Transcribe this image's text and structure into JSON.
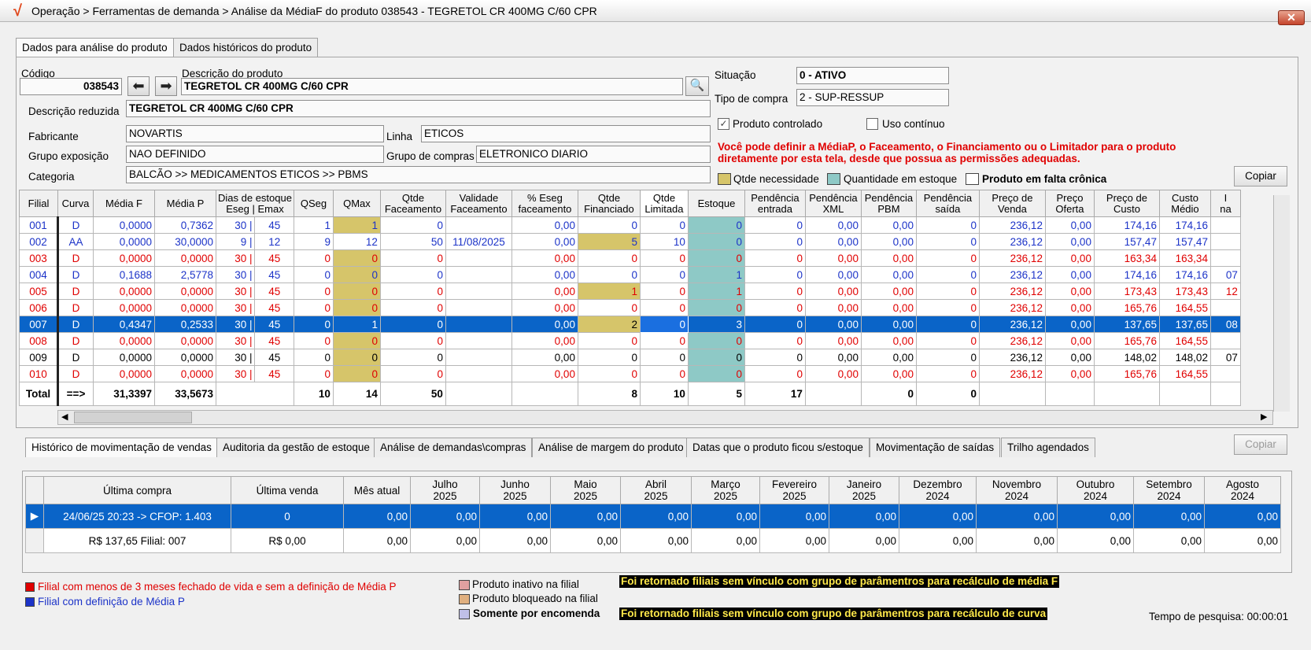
{
  "window": {
    "title": "Operação > Ferramentas de demanda > Análise da MédiaF do produto 038543 - TEGRETOL CR 400MG C/60 CPR",
    "close_label": "✕"
  },
  "tabs": [
    "Dados para análise do produto",
    "Dados históricos do produto"
  ],
  "form": {
    "codigo_label": "Código",
    "codigo": "038543",
    "descricao_label": "Descrição do produto",
    "descricao": "TEGRETOL CR 400MG C/60 CPR",
    "desc_reduzida_label": "Descrição reduzida",
    "desc_reduzida": "TEGRETOL CR 400MG C/60 CPR",
    "fabricante_label": "Fabricante",
    "fabricante": "NOVARTIS",
    "linha_label": "Linha",
    "linha": "ETICOS",
    "grupo_exposicao_label": "Grupo exposição",
    "grupo_exposicao": "NAO DEFINIDO",
    "grupo_compras_label": "Grupo de compras",
    "grupo_compras": "ELETRONICO DIARIO",
    "categoria_label": "Categoria",
    "categoria": "BALCÃO >> MEDICAMENTOS ETICOS >> PBMS",
    "situacao_label": "Situação",
    "situacao": "0 - ATIVO",
    "tipo_compra_label": "Tipo de compra",
    "tipo_compra": "2 - SUP-RESSUP",
    "produto_controlado_label": "Produto controlado",
    "produto_controlado": true,
    "uso_continuo_label": "Uso contínuo",
    "uso_continuo": false
  },
  "warning": "Você pode definir a MédiaP, o Faceamento, o Financiamento ou o Limitador para o produto diretamente por esta tela, desde que possua as permissões adequadas.",
  "legend_top": {
    "necessidade": "Qtde necessidade",
    "estoque": "Quantidade em estoque",
    "falta": "Produto em falta crônica"
  },
  "copy_label": "Copiar",
  "grid": {
    "headers": [
      [
        "Filial"
      ],
      [
        "Curva"
      ],
      [
        "Média F"
      ],
      [
        "Média P"
      ],
      [
        "Dias de estoque",
        "Eseg | Emax"
      ],
      [
        "QSeg"
      ],
      [
        "QMax"
      ],
      [
        "Qtde",
        "Faceamento"
      ],
      [
        "Validade",
        "Faceamento"
      ],
      [
        "% Eseg",
        "faceamento"
      ],
      [
        "Qtde",
        "Financiado"
      ],
      [
        "Qtde",
        "Limitada"
      ],
      [
        "Estoque"
      ],
      [
        "Pendência",
        "entrada"
      ],
      [
        "Pendência",
        "XML"
      ],
      [
        "Pendência",
        "PBM"
      ],
      [
        "Pendência",
        "saída"
      ],
      [
        "Preço de",
        "Venda"
      ],
      [
        "Preço",
        "Oferta"
      ],
      [
        "Preço de",
        "Custo"
      ],
      [
        "Custo",
        "Médio"
      ],
      [
        "I",
        "na"
      ]
    ],
    "rows": [
      {
        "style": "blue",
        "cells": [
          "001",
          "D",
          "0,0000",
          "0,7362",
          "30",
          "45",
          "1",
          "1",
          "0",
          "",
          "0,00",
          "0",
          "0",
          "0",
          "0",
          "0,00",
          "0,00",
          "0",
          "236,12",
          "0,00",
          "174,16",
          "174,16",
          ""
        ]
      },
      {
        "style": "blue",
        "cells": [
          "002",
          "AA",
          "0,0000",
          "30,0000",
          "9",
          "12",
          "9",
          "12",
          "50",
          "11/08/2025",
          "0,00",
          "5",
          "10",
          "0",
          "0",
          "0,00",
          "0,00",
          "0",
          "236,12",
          "0,00",
          "157,47",
          "157,47",
          ""
        ]
      },
      {
        "style": "red",
        "cells": [
          "003",
          "D",
          "0,0000",
          "0,0000",
          "30",
          "45",
          "0",
          "0",
          "0",
          "",
          "0,00",
          "0",
          "0",
          "0",
          "0",
          "0,00",
          "0,00",
          "0",
          "236,12",
          "0,00",
          "163,34",
          "163,34",
          ""
        ]
      },
      {
        "style": "blue",
        "cells": [
          "004",
          "D",
          "0,1688",
          "2,5778",
          "30",
          "45",
          "0",
          "0",
          "0",
          "",
          "0,00",
          "0",
          "0",
          "1",
          "0",
          "0,00",
          "0,00",
          "0",
          "236,12",
          "0,00",
          "174,16",
          "174,16",
          "07"
        ]
      },
      {
        "style": "red",
        "cells": [
          "005",
          "D",
          "0,0000",
          "0,0000",
          "30",
          "45",
          "0",
          "0",
          "0",
          "",
          "0,00",
          "1",
          "0",
          "1",
          "0",
          "0,00",
          "0,00",
          "0",
          "236,12",
          "0,00",
          "173,43",
          "173,43",
          "12"
        ]
      },
      {
        "style": "red",
        "cells": [
          "006",
          "D",
          "0,0000",
          "0,0000",
          "30",
          "45",
          "0",
          "0",
          "0",
          "",
          "0,00",
          "0",
          "0",
          "0",
          "0",
          "0,00",
          "0,00",
          "0",
          "236,12",
          "0,00",
          "165,76",
          "164,55",
          ""
        ]
      },
      {
        "style": "sel",
        "cells": [
          "007",
          "D",
          "0,4347",
          "0,2533",
          "30",
          "45",
          "0",
          "1",
          "0",
          "",
          "0,00",
          "2",
          "0",
          "3",
          "0",
          "0,00",
          "0,00",
          "0",
          "236,12",
          "0,00",
          "137,65",
          "137,65",
          "08"
        ]
      },
      {
        "style": "red",
        "cells": [
          "008",
          "D",
          "0,0000",
          "0,0000",
          "30",
          "45",
          "0",
          "0",
          "0",
          "",
          "0,00",
          "0",
          "0",
          "0",
          "0",
          "0,00",
          "0,00",
          "0",
          "236,12",
          "0,00",
          "165,76",
          "164,55",
          ""
        ]
      },
      {
        "style": "black",
        "cells": [
          "009",
          "D",
          "0,0000",
          "0,0000",
          "30",
          "45",
          "0",
          "0",
          "0",
          "",
          "0,00",
          "0",
          "0",
          "0",
          "0",
          "0,00",
          "0,00",
          "0",
          "236,12",
          "0,00",
          "148,02",
          "148,02",
          "07"
        ]
      },
      {
        "style": "red",
        "cells": [
          "010",
          "D",
          "0,0000",
          "0,0000",
          "30",
          "45",
          "0",
          "0",
          "0",
          "",
          "0,00",
          "0",
          "0",
          "0",
          "0",
          "0,00",
          "0,00",
          "0",
          "236,12",
          "0,00",
          "165,76",
          "164,55",
          ""
        ]
      }
    ],
    "total": [
      "Total",
      "==>",
      "31,3397",
      "33,5673",
      "",
      "10",
      "14",
      "50",
      "",
      "",
      "8",
      "10",
      "5",
      "17",
      "",
      "0",
      "0",
      "",
      "",
      "",
      "",
      ""
    ]
  },
  "tabs2": [
    "Histórico de movimentação de vendas",
    "Auditoria da gestão de estoque",
    "Análise de demandas\\compras",
    "Análise de margem do produto",
    "Datas que o produto ficou s/estoque",
    "Movimentação de saídas",
    "Trilho agendados"
  ],
  "grid2": {
    "headers": [
      [
        "Última compra"
      ],
      [
        "Última venda"
      ],
      [
        "Mês atual"
      ],
      [
        "Julho",
        "2025"
      ],
      [
        "Junho",
        "2025"
      ],
      [
        "Maio",
        "2025"
      ],
      [
        "Abril",
        "2025"
      ],
      [
        "Março",
        "2025"
      ],
      [
        "Fevereiro",
        "2025"
      ],
      [
        "Janeiro",
        "2025"
      ],
      [
        "Dezembro",
        "2024"
      ],
      [
        "Novembro",
        "2024"
      ],
      [
        "Outubro",
        "2024"
      ],
      [
        "Setembro",
        "2024"
      ],
      [
        "Agosto",
        "2024"
      ]
    ],
    "rows": [
      {
        "ind": "▶",
        "cells": [
          "24/06/25 20:23 -> CFOP: 1.403",
          "0",
          "0,00",
          "0,00",
          "0,00",
          "0,00",
          "0,00",
          "0,00",
          "0,00",
          "0,00",
          "0,00",
          "0,00",
          "0,00",
          "0,00",
          "0,00"
        ]
      },
      {
        "ind": "",
        "cells": [
          "R$ 137,65 Filial: 007",
          "R$ 0,00",
          "0,00",
          "0,00",
          "0,00",
          "0,00",
          "0,00",
          "0,00",
          "0,00",
          "0,00",
          "0,00",
          "0,00",
          "0,00",
          "0,00",
          "0,00"
        ]
      }
    ]
  },
  "legend_bottom": {
    "red": "Filial com menos de 3 meses fechado de vida e sem a definição de Média P",
    "blue": "Filial com definição de Média P",
    "inativo": "Produto inativo na filial",
    "bloqueado": "Produto bloqueado na filial",
    "encomenda": "Somente por encomenda",
    "alert1": "Foi retornado filiais sem vínculo com grupo de parâmentros para recálculo de média F",
    "alert2": "Foi retornado filiais sem vínculo com grupo de parâmentros para recálculo de curva",
    "tempo": "Tempo de pesquisa: 00:00:01"
  },
  "colors": {
    "selected": "#0a64c8",
    "red_text": "#e00000",
    "blue_text": "#1c33c8",
    "necessidade": "#d6c56a",
    "estoque": "#8ec9c6"
  }
}
